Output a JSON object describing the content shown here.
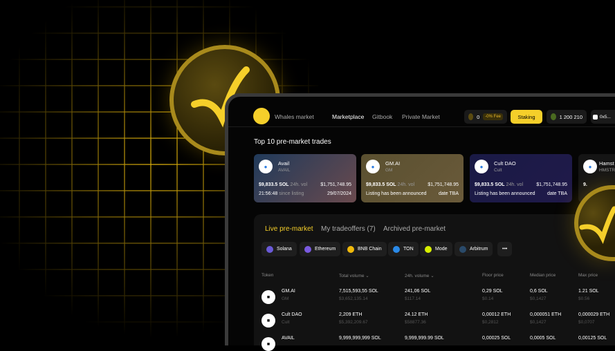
{
  "colors": {
    "accent": "#f5cf2a",
    "background": "#000000",
    "panel": "#121212"
  },
  "header": {
    "brand": "Whales market",
    "nav": [
      "Marketplace",
      "Gitbook",
      "Private Market"
    ],
    "points": "0",
    "fee_badge": "-0% Fee",
    "staking_label": "Staking",
    "balance": "1 200 210",
    "wallet": "0x5..."
  },
  "top_trades": {
    "title": "Top 10 pre-market trades",
    "cards": [
      {
        "name": "Avail",
        "symbol": "AVAIL",
        "vol": "$9,833.5 SOL",
        "vol_label": "24h. vol",
        "usd": "$1,751,748.95",
        "status": "21:56:48",
        "status_label": "since listing",
        "date": "29/07/2024"
      },
      {
        "name": "GM.AI",
        "symbol": "GM",
        "vol": "$9,833.5 SOL",
        "vol_label": "24h. vol",
        "usd": "$1,751,748.95",
        "status": "Listing has been announced",
        "status_label": "",
        "date": "date TBA"
      },
      {
        "name": "Cult DAO",
        "symbol": "Cult",
        "vol": "$9,833.5 SOL",
        "vol_label": "24h. vol",
        "usd": "$1,751,748.95",
        "status": "Listing has been announced",
        "status_label": "",
        "date": "date TBA"
      },
      {
        "name": "Hamst",
        "symbol": "HMSTR",
        "vol": "9.",
        "vol_label": "",
        "usd": "",
        "status": "",
        "status_label": "",
        "date": ""
      }
    ]
  },
  "market": {
    "tabs": [
      "Live pre-market",
      "My tradeoffers (7)",
      "Archived pre-market"
    ],
    "chains": [
      "Solana",
      "Ethereum",
      "BNB Chain",
      "TON",
      "Mode",
      "Arbitrum",
      "•••"
    ],
    "columns": [
      "Token",
      "Total volume",
      "24h. volume",
      "Floor price",
      "Median price",
      "Max price"
    ],
    "rows": [
      {
        "name": "GM.AI",
        "symbol": "GM",
        "total": "7,515,593,55 SOL",
        "total_usd": "$3,652,135.14",
        "day": "241,06 SOL",
        "day_usd": "$117.14",
        "floor": "0,29 SOL",
        "floor_usd": "$0.14",
        "median": "0,6 SOL",
        "median_usd": "$0,1427",
        "max": "1.21 SOL",
        "max_usd": "$0.56"
      },
      {
        "name": "Cult DAO",
        "symbol": "Cult",
        "total": "2,209 ETH",
        "total_usd": "$5,392,209.67",
        "day": "24.12 ETH",
        "day_usd": "$58877.36",
        "floor": "0,00012 ETH",
        "floor_usd": "$0,2812",
        "median": "0,000051 ETH",
        "median_usd": "$0,1427",
        "max": "0,000029 ETH",
        "max_usd": "$0,0707"
      },
      {
        "name": "AVAIL",
        "symbol": "",
        "total": "9,999,999,999 SOL",
        "total_usd": "",
        "day": "9,999,999.99 SOL",
        "day_usd": "",
        "floor": "0,00025 SOL",
        "floor_usd": "",
        "median": "0,0005 SOL",
        "median_usd": "",
        "max": "0,00125 SOL",
        "max_usd": ""
      }
    ]
  }
}
